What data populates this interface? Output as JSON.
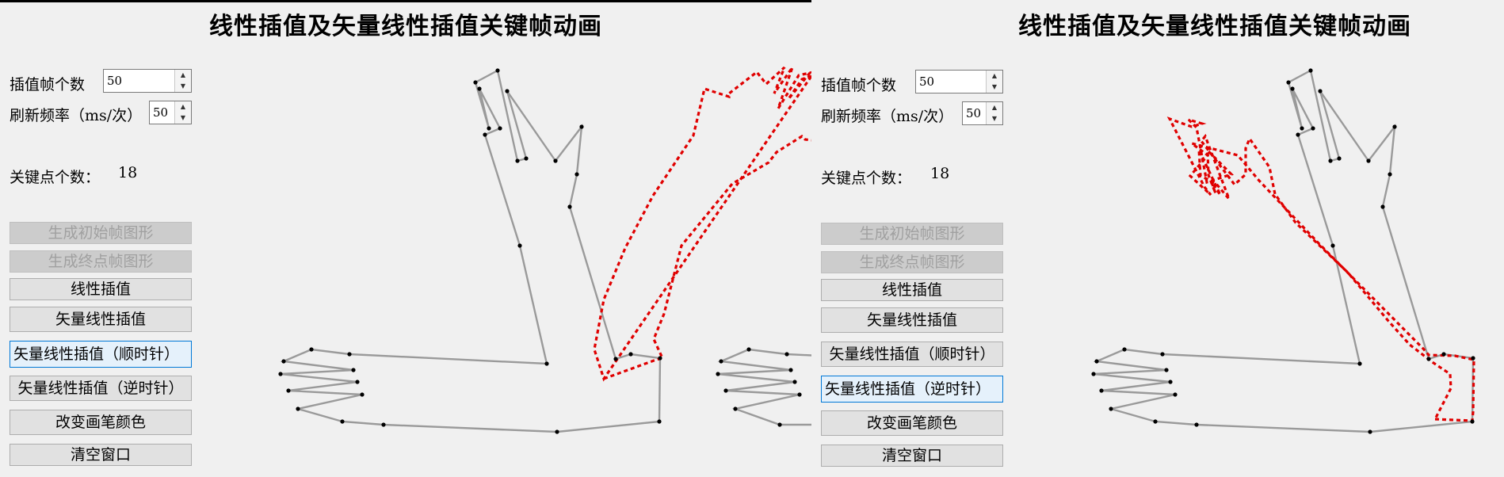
{
  "panels": [
    {
      "title": "线性插值及矢量线性插值关键帧动画",
      "frames_label": "插值帧个数",
      "frames_value": "50",
      "refresh_label": "刷新频率（ms/次）",
      "refresh_value": "50",
      "keypoints_label": "关键点个数：",
      "keypoints_value": "18",
      "buttons": [
        "生成初始帧图形",
        "生成终点帧图形",
        "线性插值",
        "矢量线性插值",
        "矢量线性插值（顺时针）",
        "矢量线性插值（逆时针）",
        "改变画笔颜色",
        "清空窗口"
      ],
      "focused_button": 4
    },
    {
      "title": "线性插值及矢量线性插值关键帧动画",
      "frames_label": "插值帧个数",
      "frames_value": "50",
      "refresh_label": "刷新频率（ms/次）",
      "refresh_value": "50",
      "keypoints_label": "关键点个数：",
      "keypoints_value": "18",
      "buttons": [
        "生成初始帧图形",
        "生成终点帧图形",
        "线性插值",
        "矢量线性插值",
        "矢量线性插值（顺时针）",
        "矢量线性插值（逆时针）",
        "改变画笔颜色",
        "清空窗口"
      ],
      "focused_button": 5
    }
  ],
  "colors": {
    "shape_stroke": "#9a9a9a",
    "keypoint": "#000000",
    "interpolated_stroke": "#e00000",
    "background": "#f0f0f0"
  }
}
